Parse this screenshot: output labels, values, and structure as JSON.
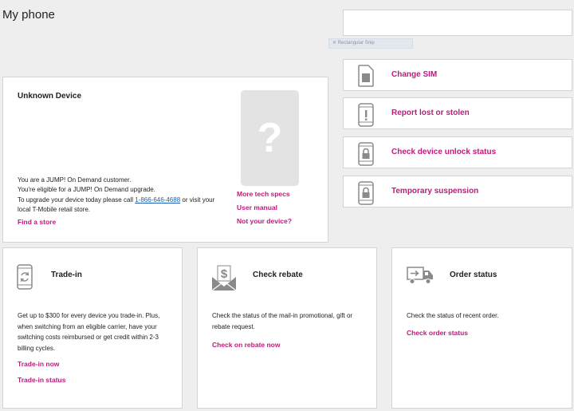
{
  "page": {
    "title": "My phone"
  },
  "tag": {
    "text": "Rectangular Snip"
  },
  "device": {
    "title": "Unknown Device",
    "line1": "You are a JUMP! On Demand customer.",
    "line2": "You're eligible for a JUMP! On Demand upgrade.",
    "line3_pre": "To upgrade your device today please call ",
    "phone": "1-866-646-4688",
    "line3_post": " or visit your",
    "line4": "local T-Mobile retail store.",
    "find_store": "Find a store",
    "image_glyph": "?",
    "links": [
      "More tech specs",
      "User manual",
      "Not your device?"
    ]
  },
  "actions": [
    {
      "label": "Change SIM",
      "icon": "sim-icon"
    },
    {
      "label": "Report lost or stolen",
      "icon": "phone-alert-icon"
    },
    {
      "label": "Check device unlock status",
      "icon": "phone-lock-icon"
    },
    {
      "label": "Temporary suspension",
      "icon": "phone-lock-icon"
    }
  ],
  "trade_in": {
    "title": "Trade-in",
    "text": "Get up to $300 for every device you trade-in. Plus, when switching from an eligible carrier, have your switching costs reimbursed or get credit within 2-3 billing cycles.",
    "link1": "Trade-in now",
    "link2": "Trade-in status"
  },
  "rebate": {
    "title": "Check rebate",
    "text": "Check the status of the mail-in promotional, gift or rebate request.",
    "link": "Check on rebate now"
  },
  "order": {
    "title": "Order status",
    "text": "Check the status of recent order.",
    "link": "Check order status"
  },
  "colors": {
    "accent": "#c2187c",
    "link_blue": "#1a5fb4",
    "icon_gray": "#8a8a8a"
  }
}
